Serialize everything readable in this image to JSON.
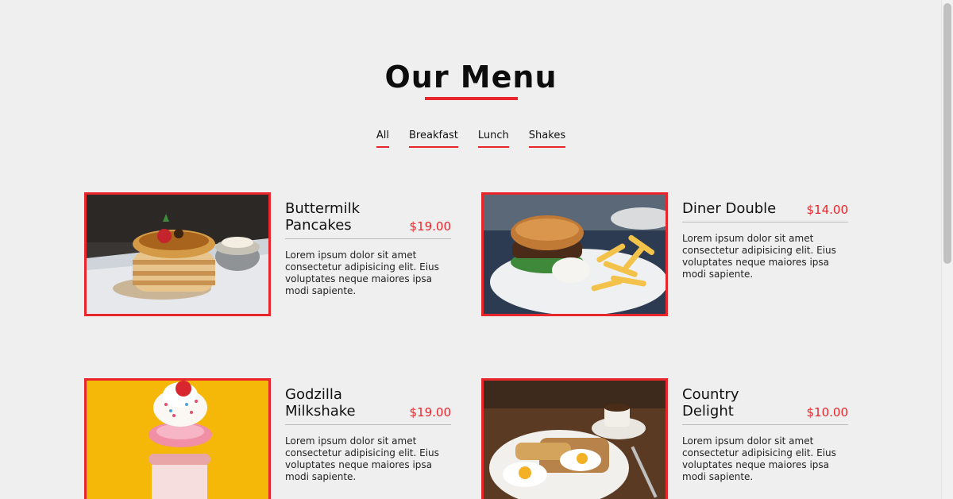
{
  "page": {
    "title": "Our Menu"
  },
  "filters": [
    {
      "label": "All"
    },
    {
      "label": "Breakfast"
    },
    {
      "label": "Lunch"
    },
    {
      "label": "Shakes"
    }
  ],
  "items": [
    {
      "name": "Buttermilk Pancakes",
      "price": "$19.00",
      "description": "Lorem ipsum dolor sit amet consectetur adipisicing elit. Eius voluptates neque maiores ipsa modi sapiente.",
      "image": "pancakes-photo"
    },
    {
      "name": "Diner Double",
      "price": "$14.00",
      "description": "Lorem ipsum dolor sit amet consectetur adipisicing elit. Eius voluptates neque maiores ipsa modi sapiente.",
      "image": "burger-photo"
    },
    {
      "name": "Godzilla Milkshake",
      "price": "$19.00",
      "description": "Lorem ipsum dolor sit amet consectetur adipisicing elit. Eius voluptates neque maiores ipsa modi sapiente.",
      "image": "milkshake-photo"
    },
    {
      "name": "Country Delight",
      "price": "$10.00",
      "description": "Lorem ipsum dolor sit amet consectetur adipisicing elit. Eius voluptates neque maiores ipsa modi sapiente.",
      "image": "breakfast-plate-photo"
    }
  ],
  "colors": {
    "accent": "#e8262c",
    "background": "#f0efef",
    "text": "#111111"
  }
}
